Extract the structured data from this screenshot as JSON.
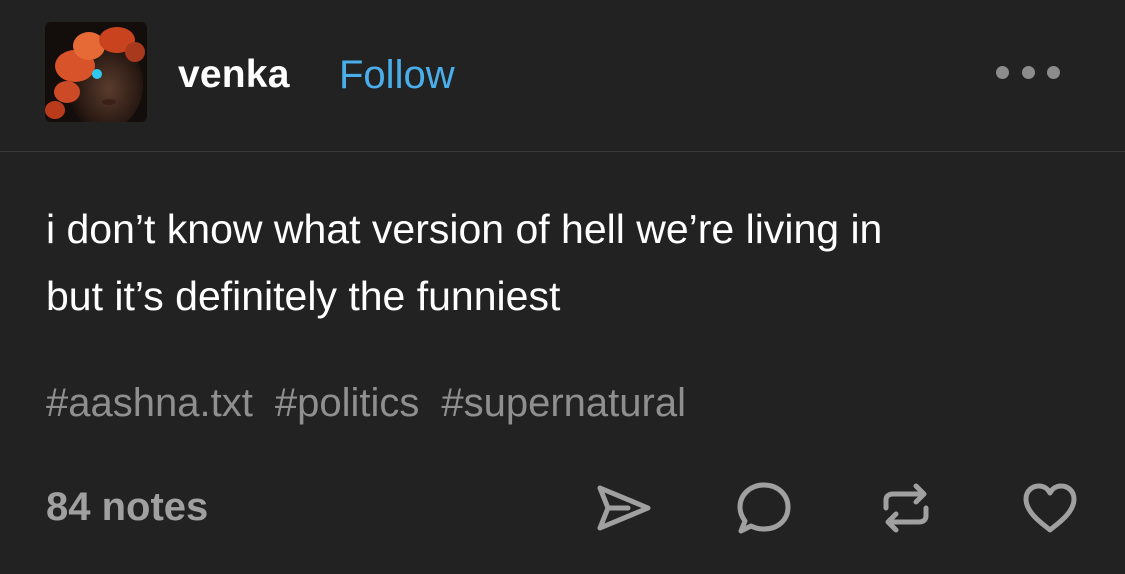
{
  "post": {
    "username": "venka",
    "follow_label": "Follow",
    "more_icon": "more-horizontal-icon",
    "avatar_icon": "user-avatar",
    "lines": [
      "i don’t know what version of hell we’re living in",
      "but it’s definitely the funniest"
    ],
    "tags": [
      "#aashna.txt",
      "#politics",
      "#supernatural"
    ],
    "notes": "84 notes",
    "actions": [
      "share-icon",
      "reply-icon",
      "reblog-icon",
      "like-icon"
    ]
  },
  "colors": {
    "background": "#222222",
    "text": "#ffffff",
    "link": "#4aaeea",
    "muted": "#8f8f8f",
    "icon": "#a0a0a0"
  }
}
